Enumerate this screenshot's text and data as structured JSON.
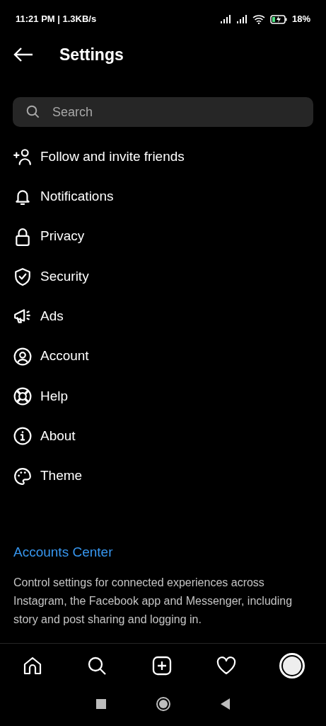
{
  "status_bar": {
    "time": "11:21 PM | 1.3KB/s",
    "battery": "18%"
  },
  "header": {
    "title": "Settings"
  },
  "search": {
    "placeholder": "Search"
  },
  "menu": [
    {
      "label": "Follow and invite friends"
    },
    {
      "label": "Notifications"
    },
    {
      "label": "Privacy"
    },
    {
      "label": "Security"
    },
    {
      "label": "Ads"
    },
    {
      "label": "Account"
    },
    {
      "label": "Help"
    },
    {
      "label": "About"
    },
    {
      "label": "Theme"
    }
  ],
  "accounts_center": {
    "title": "Accounts Center",
    "description": "Control settings for connected experiences across Instagram, the Facebook app and Messenger, including story and post sharing and logging in."
  }
}
